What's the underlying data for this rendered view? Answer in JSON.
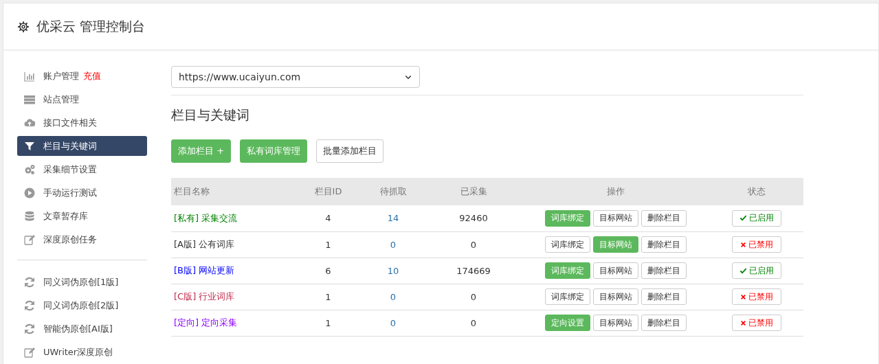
{
  "header": {
    "title": "优采云 管理控制台"
  },
  "sidebar": {
    "groups": [
      [
        {
          "label": "账户管理",
          "badge": "充值",
          "selected": false
        },
        {
          "label": "站点管理",
          "selected": false
        },
        {
          "label": "接口文件相关",
          "selected": false
        },
        {
          "label": "栏目与关键词",
          "selected": true
        },
        {
          "label": "采集细节设置",
          "selected": false
        },
        {
          "label": "手动运行测试",
          "selected": false
        },
        {
          "label": "文章暂存库",
          "selected": false
        },
        {
          "label": "深度原创任务",
          "selected": false
        }
      ],
      [
        {
          "label": "同义词伪原创[1版]",
          "selected": false
        },
        {
          "label": "同义词伪原创[2版]",
          "selected": false
        },
        {
          "label": "智能伪原创[AI版]",
          "selected": false
        },
        {
          "label": "UWriter深度原创",
          "selected": false
        }
      ]
    ]
  },
  "site_select": {
    "value": "https://www.ucaiyun.com"
  },
  "section_title": "栏目与关键词",
  "toolbar": [
    {
      "label": "添加栏目 +",
      "kind": "green"
    },
    {
      "label": "私有词库管理",
      "kind": "green"
    },
    {
      "label": "批量添加栏目",
      "kind": "plain"
    }
  ],
  "table": {
    "columns": [
      "栏目名称",
      "栏目ID",
      "待抓取",
      "已采集",
      "操作",
      "状态"
    ],
    "rows": [
      {
        "tag": "[私有]",
        "name": "采集交流",
        "color": "#008000",
        "id": "4",
        "pending": "14",
        "collected": "92460",
        "actions": [
          {
            "label": "词库绑定",
            "selected": true
          },
          {
            "label": "目标网站",
            "selected": false
          },
          {
            "label": "删除栏目",
            "selected": false
          }
        ],
        "enabled": true,
        "status": "已启用"
      },
      {
        "tag": "[A版]",
        "name": "公有词库",
        "color": "#333333",
        "id": "1",
        "pending": "0",
        "collected": "0",
        "actions": [
          {
            "label": "词库绑定",
            "selected": false
          },
          {
            "label": "目标网站",
            "selected": true
          },
          {
            "label": "删除栏目",
            "selected": false
          }
        ],
        "enabled": false,
        "status": "已禁用"
      },
      {
        "tag": "[B版]",
        "name": "网站更新",
        "color": "#0000ff",
        "id": "6",
        "pending": "10",
        "collected": "174669",
        "actions": [
          {
            "label": "词库绑定",
            "selected": true
          },
          {
            "label": "目标网站",
            "selected": false
          },
          {
            "label": "删除栏目",
            "selected": false
          }
        ],
        "enabled": true,
        "status": "已启用"
      },
      {
        "tag": "[C版]",
        "name": "行业词库",
        "color": "#c0294a",
        "id": "1",
        "pending": "0",
        "collected": "0",
        "actions": [
          {
            "label": "词库绑定",
            "selected": false
          },
          {
            "label": "目标网站",
            "selected": false
          },
          {
            "label": "删除栏目",
            "selected": false
          }
        ],
        "enabled": false,
        "status": "已禁用"
      },
      {
        "tag": "[定向]",
        "name": "定向采集",
        "color": "#8b00ff",
        "id": "1",
        "pending": "0",
        "collected": "0",
        "actions": [
          {
            "label": "定向设置",
            "selected": true
          },
          {
            "label": "目标网站",
            "selected": false
          },
          {
            "label": "删除栏目",
            "selected": false
          }
        ],
        "enabled": false,
        "status": "已禁用"
      }
    ]
  }
}
